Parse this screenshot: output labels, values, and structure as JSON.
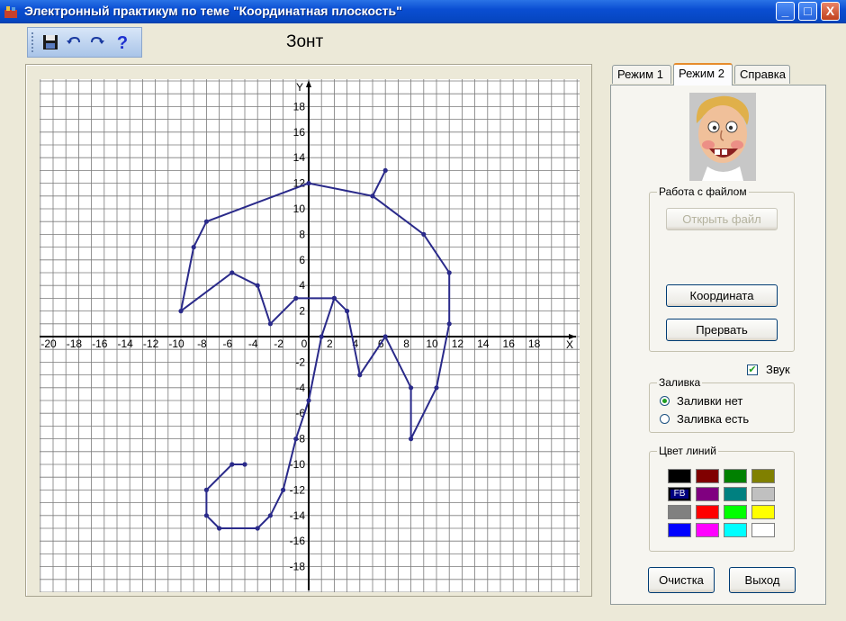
{
  "window": {
    "title": "Электронный практикум по теме \"Координатная плоскость\"",
    "minimize_glyph": "_",
    "maximize_glyph": "□",
    "close_glyph": "X"
  },
  "toolbar": {
    "icons": [
      "save-icon",
      "undo-icon",
      "redo-icon",
      "help-icon"
    ]
  },
  "exercise_title": "Зонт",
  "plot": {
    "x_axis_label": "X",
    "y_axis_label": "Y",
    "x_range": [
      -21,
      21
    ],
    "y_range": [
      -20,
      20
    ],
    "x_tick_labels": [
      "-20",
      "-18",
      "-16",
      "-14",
      "-12",
      "-10",
      "-8",
      "-6",
      "-4",
      "-2",
      "0",
      "2",
      "4",
      "6",
      "8",
      "10",
      "12",
      "14",
      "16",
      "18"
    ],
    "y_tick_labels": [
      "18",
      "16",
      "14",
      "12",
      "10",
      "8",
      "6",
      "4",
      "2",
      "-2",
      "-4",
      "-6",
      "-8",
      "-10",
      "-12",
      "-14",
      "-16",
      "-18"
    ],
    "line_color": "#2a2a8a",
    "polyline": [
      [
        6,
        13
      ],
      [
        5,
        11
      ],
      [
        0,
        12
      ],
      [
        -8,
        9
      ],
      [
        -9,
        7
      ],
      [
        -10,
        2
      ],
      [
        -6,
        5
      ],
      [
        -4,
        4
      ],
      [
        -3,
        1
      ],
      [
        -1,
        3
      ],
      [
        2,
        3
      ],
      [
        3,
        2
      ],
      [
        4,
        -3
      ],
      [
        6,
        0
      ],
      [
        8,
        -4
      ],
      [
        8,
        -8
      ],
      [
        10,
        -4
      ],
      [
        11,
        1
      ],
      [
        11,
        5
      ],
      [
        9,
        8
      ],
      [
        5,
        11
      ]
    ],
    "handle": [
      [
        2,
        3
      ],
      [
        1,
        0
      ],
      [
        0,
        -5
      ],
      [
        -1,
        -8
      ],
      [
        -2,
        -12
      ],
      [
        -3,
        -14
      ],
      [
        -4,
        -15
      ],
      [
        -7,
        -15
      ],
      [
        -8,
        -14
      ],
      [
        -8,
        -12
      ],
      [
        -6,
        -10
      ],
      [
        -5,
        -10
      ]
    ]
  },
  "tabs": [
    {
      "label": "Режим 1",
      "active": false
    },
    {
      "label": "Режим 2",
      "active": true
    },
    {
      "label": "Справка",
      "active": false
    }
  ],
  "file_group": {
    "title": "Работа с файлом",
    "open_button": "Открыть файл",
    "coordinate_button": "Координата",
    "interrupt_button": "Прервать"
  },
  "sound_checkbox": {
    "label": "Звук",
    "checked": true
  },
  "fill_group": {
    "title": "Заливка",
    "options": [
      {
        "label": "Заливки нет",
        "selected": true
      },
      {
        "label": "Заливка есть",
        "selected": false
      }
    ]
  },
  "line_color_group": {
    "title": "Цвет линий",
    "selected_label": "FB",
    "swatches": [
      "#000000",
      "#800000",
      "#008000",
      "#808000",
      "#000080",
      "#800080",
      "#008080",
      "#c0c0c0",
      "#808080",
      "#ff0000",
      "#00ff00",
      "#ffff00",
      "#0000ff",
      "#ff00ff",
      "#00ffff",
      "#ffffff"
    ]
  },
  "buttons": {
    "clear": "Очистка",
    "exit": "Выход"
  }
}
